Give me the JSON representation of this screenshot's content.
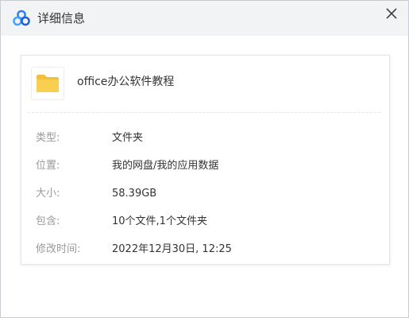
{
  "window": {
    "title": "详细信息",
    "close_symbol": "×"
  },
  "file": {
    "name": "office办公软件教程",
    "icon": "folder-icon",
    "icon_color": "#F7C64A"
  },
  "details": {
    "type_label": "类型:",
    "type_value": "文件夹",
    "location_label": "位置:",
    "location_value": "我的网盘/我的应用数据",
    "size_label": "大小:",
    "size_value": "58.39GB",
    "contains_label": "包含:",
    "contains_value": "10个文件,1个文件夹",
    "modified_label": "修改时间:",
    "modified_value": "2022年12月30日, 12:25"
  },
  "colors": {
    "brand_blue": "#2A7CF6",
    "label_gray": "#9A9A9A"
  }
}
